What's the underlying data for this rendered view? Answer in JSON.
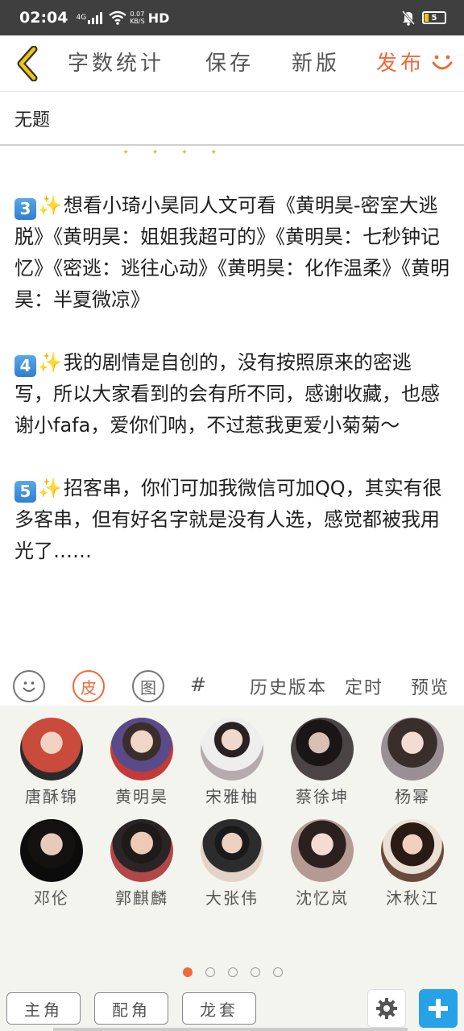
{
  "status_bar": {
    "time": "02:04",
    "net": "4G",
    "speed_top": "0.07",
    "speed_bottom": "KB/S",
    "hd": "HD",
    "battery": "5"
  },
  "toolbar": {
    "word_count": "字数统计",
    "save": "保存",
    "new_version": "新版",
    "publish": "发布"
  },
  "title": "无题",
  "content": {
    "p3": {
      "keycap": "3",
      "text": "想看小琦小昊同人文可看《黄明昊-密室大逃脱》《黄明昊：姐姐我超可的》《黄明昊：七秒钟记忆》《密逃：逃往心动》《黄明昊：化作温柔》《黄明昊：半夏微凉》"
    },
    "p4": {
      "keycap": "4",
      "text": "我的剧情是自创的，没有按照原来的密逃写，所以大家看到的会有所不同，感谢收藏，也感谢小fafa，爱你们呐，不过惹我更爱小菊菊～"
    },
    "p5": {
      "keycap": "5",
      "text": "招客串，你们可加我微信可加QQ，其实有很多客串，但有好名字就是没有人选，感觉都被我用光了……"
    }
  },
  "format_bar": {
    "skin": "皮",
    "image": "图",
    "hash": "#",
    "history": "历史版本",
    "timer": "定时",
    "preview": "预览"
  },
  "characters": [
    {
      "name": "唐酥锦",
      "color": "#c94b3c"
    },
    {
      "name": "黄明昊",
      "color": "#5a4a8a"
    },
    {
      "name": "宋雅柚",
      "color": "#9a8f90"
    },
    {
      "name": "蔡徐坤",
      "color": "#2e2a2a"
    },
    {
      "name": "杨幂",
      "color": "#6d6266"
    },
    {
      "name": "邓伦",
      "color": "#1e1a18"
    },
    {
      "name": "郭麒麟",
      "color": "#8a3a3a"
    },
    {
      "name": "大张伟",
      "color": "#c2a28f"
    },
    {
      "name": "沈忆岚",
      "color": "#8d6f6a"
    },
    {
      "name": "沐秋江",
      "color": "#5a3a30"
    }
  ],
  "pager": {
    "pages": 5,
    "current": 1
  },
  "bottom": {
    "main_role": "主角",
    "support_role": "配角",
    "extra_role": "龙套"
  },
  "colors": {
    "accent": "#ef6a3a",
    "add": "#27a2e6",
    "keycap": "#3a8ad8",
    "sparkle": "#f0c62a"
  }
}
